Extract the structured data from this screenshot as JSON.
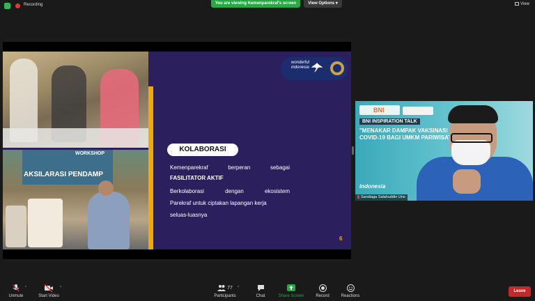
{
  "topbar": {
    "recording_label": "Recording",
    "banner_text": "You are viewing Kemenparekraf's screen",
    "view_options_label": "View Options",
    "view_label": "View"
  },
  "slide": {
    "logo_text": "wonderful indonesia",
    "photo_workshop_label": "WORKSHOP",
    "photo_banner_text": "AKSILARASI PENDAMP",
    "heading": "KOLABORASI",
    "line1": "Kemenparekraf berperan sebagai",
    "line2": "FASILITATOR AKTIF",
    "line3": "Berkolaborasi dengan ekosistem",
    "line4": "Parekraf  untuk ciptakan lapangan kerja",
    "line5": "seluas-luasnya",
    "page_number": "6"
  },
  "video": {
    "sponsor": "BNI",
    "event_title": "BNI INSPIRATION TALK",
    "event_subtitle": "\"MENAKAR DAMPAK VAKSINASI COVID-19 BAGI UMKM PARIWISATA\"",
    "bottom_logo": "Indonesia",
    "participant_name": "Sandiaga Salahuddin Uno"
  },
  "toolbar": {
    "unmute": "Unmute",
    "start_video": "Start Video",
    "participants": "Participants",
    "participants_count": "77",
    "chat": "Chat",
    "share_screen": "Share Screen",
    "record": "Record",
    "reactions": "Reactions",
    "leave": "Leave"
  },
  "colors": {
    "share_green": "#28a745",
    "leave_red": "#c62828",
    "slide_purple": "#2c1f5e",
    "accent_yellow": "#f2a900"
  }
}
